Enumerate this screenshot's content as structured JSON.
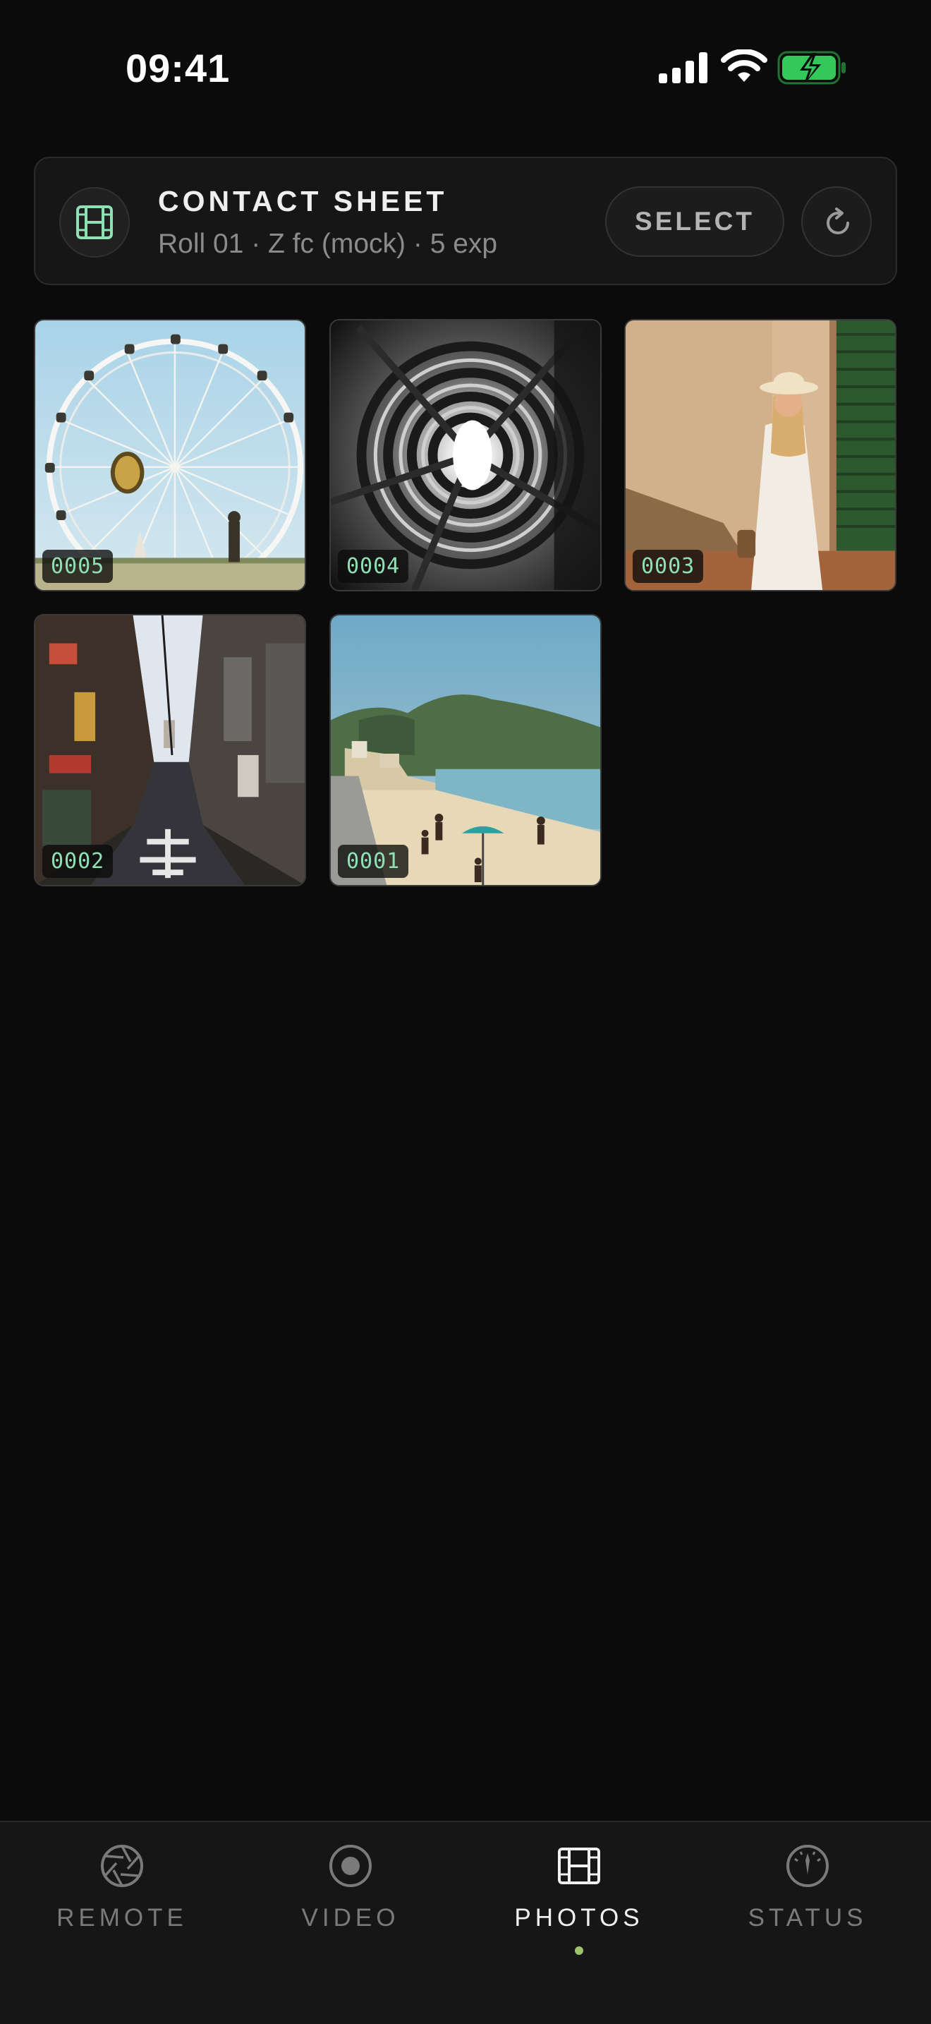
{
  "status_bar": {
    "time": "09:41"
  },
  "header": {
    "title": "CONTACT SHEET",
    "subtitle": "Roll 01 · Z fc (mock) · 5 exp",
    "select_label": "SELECT",
    "icons": {
      "badge": "film-icon",
      "refresh": "refresh-icon"
    }
  },
  "photos": [
    {
      "frame": "0005",
      "subject": "ferris wheel"
    },
    {
      "frame": "0004",
      "subject": "spiral staircase"
    },
    {
      "frame": "0003",
      "subject": "woman in sun hat"
    },
    {
      "frame": "0002",
      "subject": "narrow city alley"
    },
    {
      "frame": "0001",
      "subject": "beach with mountains"
    }
  ],
  "tabs": [
    {
      "label": "REMOTE",
      "icon": "aperture-icon",
      "active": false
    },
    {
      "label": "VIDEO",
      "icon": "record-icon",
      "active": false
    },
    {
      "label": "PHOTOS",
      "icon": "film-icon",
      "active": true
    },
    {
      "label": "STATUS",
      "icon": "gauge-icon",
      "active": false
    }
  ],
  "colors": {
    "background": "#0b0b0b",
    "card": "#161616",
    "accent_green": "#8fe0b4",
    "active_dot": "#9ec46e",
    "battery_green": "#34c759"
  }
}
